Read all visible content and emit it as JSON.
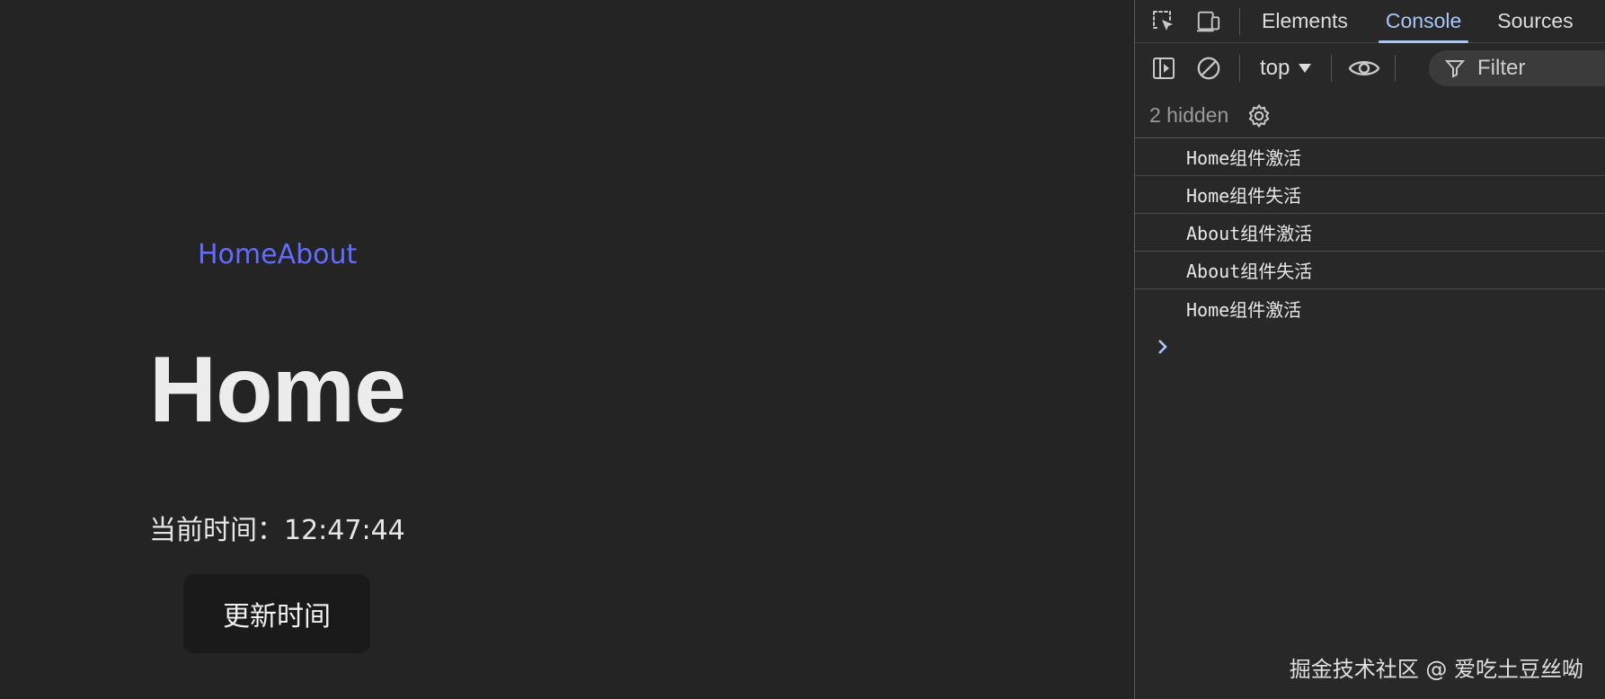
{
  "app": {
    "nav": {
      "home_label": "Home",
      "about_label": "About"
    },
    "page_title": "Home",
    "time_label": "当前时间：",
    "time_value": "12:47:44",
    "update_button_label": "更新时间"
  },
  "devtools": {
    "tabs": [
      {
        "label": "Elements",
        "active": false
      },
      {
        "label": "Console",
        "active": true
      },
      {
        "label": "Sources",
        "active": false
      }
    ],
    "context_selector": "top",
    "filter_placeholder": "Filter",
    "hidden_count_text": "2 hidden",
    "console_messages": [
      "Home组件激活",
      "Home组件失活",
      "About组件激活",
      "About组件失活",
      "Home组件激活"
    ],
    "accent_color": "#a8c7fa"
  },
  "watermark": "掘金技术社区 @ 爱吃土豆丝呦",
  "colors": {
    "page_background": "#242424",
    "link": "#646cff",
    "button_background": "#1a1a1a",
    "devtools_background": "#282828"
  },
  "icons": {
    "inspect": "inspect-element-icon",
    "device": "device-toolbar-icon",
    "sidebar": "sidebar-toggle-icon",
    "clear": "clear-console-icon",
    "eye": "live-expression-eye-icon",
    "filter": "filter-funnel-icon",
    "settings": "gear-icon",
    "prompt": "chevron-right-icon"
  }
}
